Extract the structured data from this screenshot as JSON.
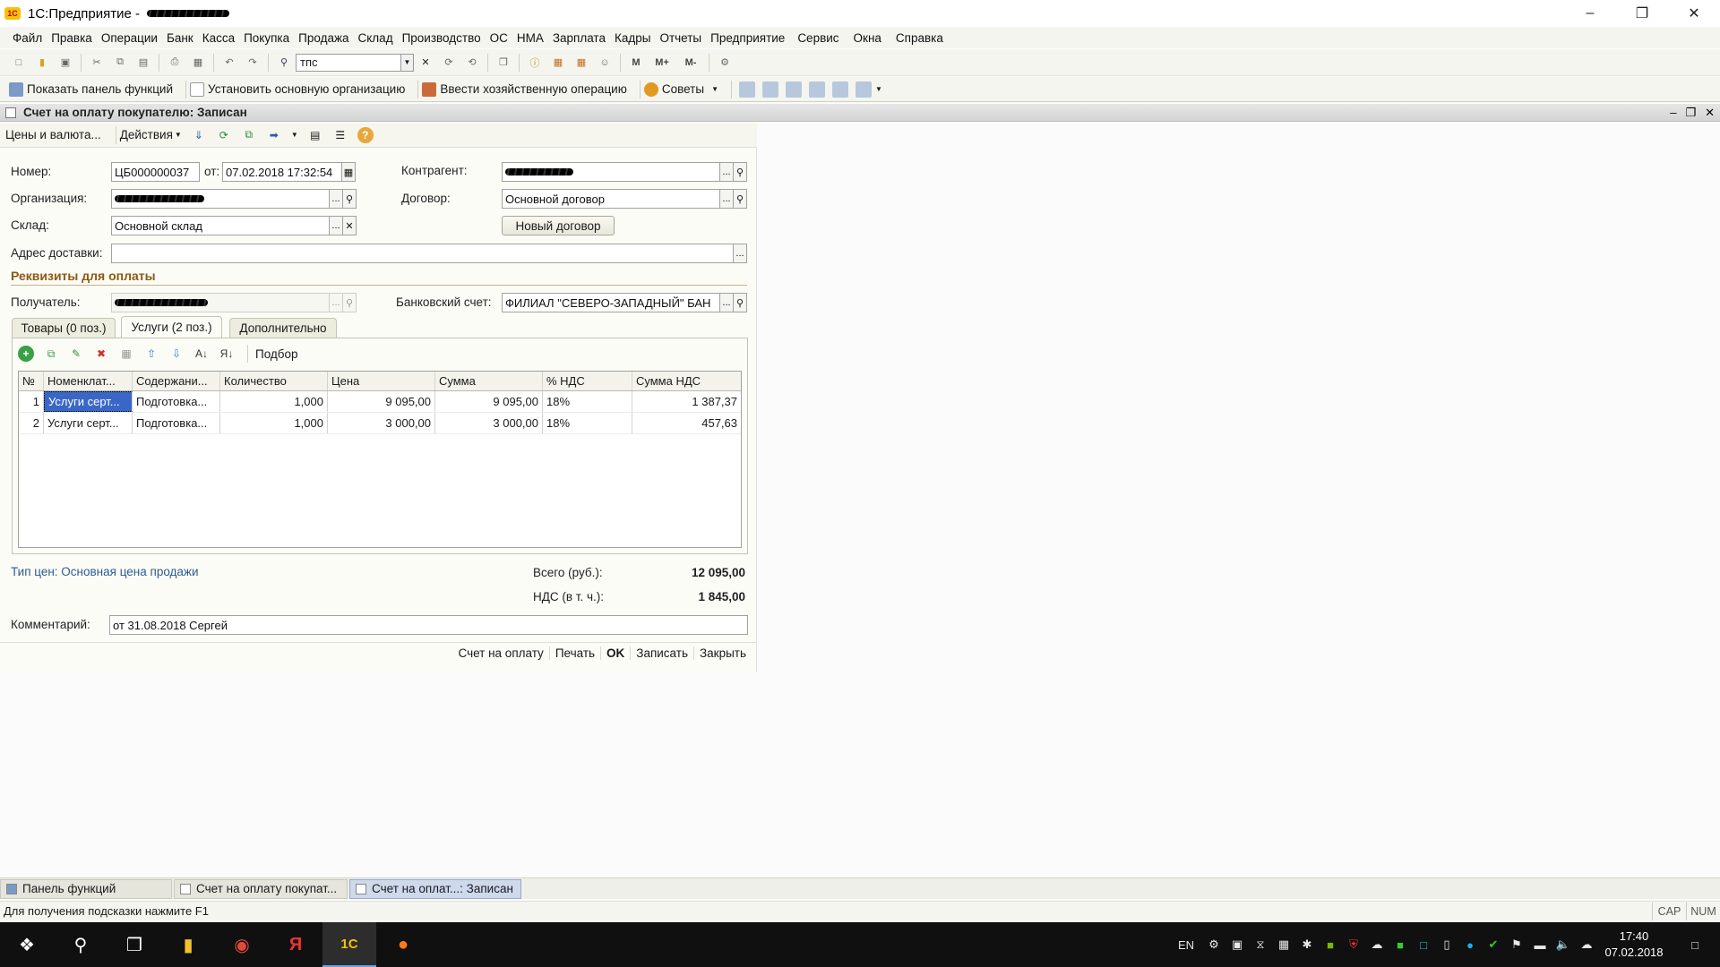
{
  "titlebar": {
    "title": "1С:Предприятие -"
  },
  "menu": [
    "Файл",
    "Правка",
    "Операции",
    "Банк",
    "Касса",
    "Покупка",
    "Продажа",
    "Склад",
    "Производство",
    "ОС",
    "НМА",
    "Зарплата",
    "Кадры",
    "Отчеты",
    "Предприятие",
    "Сервис",
    "Окна",
    "Справка"
  ],
  "toolbar1": {
    "search_value": "тпс"
  },
  "toolbar2": {
    "show_panel": "Показать панель функций",
    "set_org": "Установить основную организацию",
    "enter_op": "Ввести хозяйственную операцию",
    "tips": "Советы"
  },
  "doc": {
    "title": "Счет на оплату покупателю: Записан",
    "toolbar": {
      "prices": "Цены и валюта...",
      "actions": "Действия"
    },
    "labels": {
      "number": "Номер:",
      "from": "от:",
      "org": "Организация:",
      "warehouse": "Склад:",
      "address": "Адрес доставки:",
      "contractor": "Контрагент:",
      "contract": "Договор:",
      "recipient": "Получатель:",
      "bank_account": "Банковский счет:"
    },
    "values": {
      "number": "ЦБ000000037",
      "date": "07.02.2018 17:32:54",
      "warehouse": "Основной склад",
      "contract": "Основной договор",
      "bank_account": "ФИЛИАЛ \"СЕВЕРО-ЗАПАДНЫЙ\" БАН",
      "address": ""
    },
    "new_contract": "Новый договор",
    "section": "Реквизиты для оплаты",
    "tabs": [
      "Товары (0 поз.)",
      "Услуги (2 поз.)",
      "Дополнительно"
    ],
    "grid_toolbar": {
      "pick": "Подбор"
    },
    "grid": {
      "columns": [
        "№",
        "Номенклат...",
        "Содержани...",
        "Количество",
        "Цена",
        "Сумма",
        "% НДС",
        "Сумма НДС"
      ],
      "rows": [
        [
          "1",
          "Услуги серт...",
          "Подготовка...",
          "1,000",
          "9 095,00",
          "9 095,00",
          "18%",
          "1 387,37"
        ],
        [
          "2",
          "Услуги серт...",
          "Подготовка...",
          "1,000",
          "3 000,00",
          "3 000,00",
          "18%",
          "457,63"
        ]
      ]
    },
    "price_type": "Тип цен: Основная цена продажи",
    "total_label": "Всего (руб.):",
    "total_value": "12 095,00",
    "vat_label": "НДС (в т. ч.):",
    "vat_value": "1 845,00",
    "comment_label": "Комментарий:",
    "comment_value": "от 31.08.2018 Сергей",
    "bottom": [
      "Счет на оплату",
      "Печать",
      "OK",
      "Записать",
      "Закрыть"
    ]
  },
  "window_tabs": [
    "Панель функций",
    "Счет на оплату покупат...",
    "Счет на оплат...: Записан"
  ],
  "status": {
    "hint": "Для получения подсказки нажмите F1",
    "cap": "CAP",
    "num": "NUM"
  },
  "taskbar": {
    "lang": "EN",
    "time": "17:40",
    "date": "07.02.2018"
  }
}
